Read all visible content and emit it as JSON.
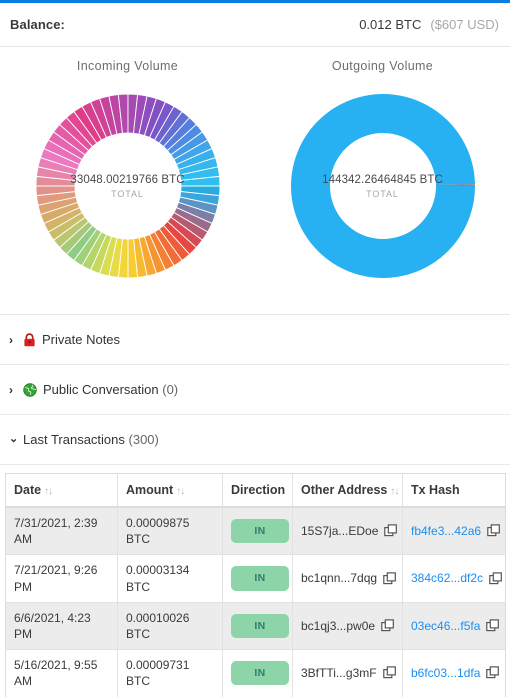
{
  "balance": {
    "label": "Balance:",
    "btc": "0.012 BTC",
    "usd": "($607 USD)"
  },
  "charts": [
    {
      "title": "Incoming Volume",
      "total": "33048.00219766 BTC",
      "subtitle": "TOTAL"
    },
    {
      "title": "Outgoing Volume",
      "total": "144342.26464845 BTC",
      "subtitle": "TOTAL"
    }
  ],
  "chart_data": [
    {
      "type": "pie",
      "title": "Incoming Volume",
      "center_label": "33048.00219766 BTC",
      "center_sublabel": "TOTAL",
      "unit": "BTC",
      "total": 33048.00219766,
      "segment_count": 60,
      "note": "Donut of many near-equal incoming transaction slices, rainbow palette, start angle 3 o'clock, clockwise",
      "values": [
        1,
        1,
        1,
        1,
        1,
        1,
        1,
        1,
        1,
        1,
        1,
        1,
        1,
        1,
        1,
        1,
        1,
        1,
        1,
        1,
        1,
        1,
        1,
        1,
        1,
        1,
        1,
        1,
        1,
        1,
        1,
        1,
        1,
        1,
        1,
        1,
        1,
        1,
        1,
        1,
        1,
        1,
        1,
        1,
        1,
        1,
        1,
        1,
        1,
        1,
        1,
        1,
        1,
        1,
        1,
        1,
        1,
        1,
        1,
        1
      ],
      "colors": [
        "#29abe2",
        "#3aa6dd",
        "#5b93c4",
        "#7b7fa8",
        "#9a6c8c",
        "#b85a6f",
        "#d64a55",
        "#e8473f",
        "#ef5a3a",
        "#f26c37",
        "#f48034",
        "#f59433",
        "#f6a832",
        "#f7bb31",
        "#f8cd31",
        "#f2d63a",
        "#e8db45",
        "#d9dd4f",
        "#c6d95c",
        "#b3d56a",
        "#a0d178",
        "#8fcd84",
        "#a6c97a",
        "#bcc570",
        "#c9bd6a",
        "#d2b368",
        "#d8aa6a",
        "#dda272",
        "#e09a7d",
        "#e2928a",
        "#e48b98",
        "#e685a7",
        "#e87fb6",
        "#ea79c2",
        "#e96fba",
        "#e765b0",
        "#e55ba6",
        "#e3519c",
        "#e14792",
        "#df3d88",
        "#d83f8f",
        "#cf4296",
        "#c6449d",
        "#bc46a4",
        "#b148ab",
        "#a64ab2",
        "#9b4cb8",
        "#8f4ebe",
        "#8350c4",
        "#7757ca",
        "#6b63d0",
        "#6070d6",
        "#567edc",
        "#4d8ce1",
        "#4599e5",
        "#3ea6e9",
        "#38b0ec",
        "#34b8ee",
        "#31bdef",
        "#2fc0f0"
      ]
    },
    {
      "type": "pie",
      "title": "Outgoing Volume",
      "center_label": "144342.26464845 BTC",
      "center_sublabel": "TOTAL",
      "unit": "BTC",
      "total": 144342.26464845,
      "segment_count": 2,
      "note": "One dominant outgoing slice plus a hairline slice at 3 o'clock",
      "values": [
        99.7,
        0.3
      ],
      "colors": [
        "#27b0f2",
        "#c0707a"
      ]
    }
  ],
  "sections": [
    {
      "label": "Private Notes",
      "count": "",
      "icon": "lock-icon",
      "expanded": false,
      "chevron": "›"
    },
    {
      "label": "Public Conversation",
      "count": "(0)",
      "icon": "globe-icon",
      "expanded": false,
      "chevron": "›"
    },
    {
      "label": "Last Transactions",
      "count": "(300)",
      "icon": "",
      "expanded": true,
      "chevron": "⌄"
    }
  ],
  "table": {
    "columns": [
      {
        "label": "Date",
        "sortable": true
      },
      {
        "label": "Amount",
        "sortable": true
      },
      {
        "label": "Direction",
        "sortable": false
      },
      {
        "label": "Other Address",
        "sortable": true
      },
      {
        "label": "Tx Hash",
        "sortable": false
      }
    ],
    "sort_glyph": "↑↓",
    "rows": [
      {
        "date": "7/31/2021, 2:39 AM",
        "amount": "0.00009875 BTC",
        "direction": "IN",
        "address": "15S7ja...EDoe",
        "hash": "fb4fe3...42a6"
      },
      {
        "date": "7/21/2021, 9:26 PM",
        "amount": "0.00003134 BTC",
        "direction": "IN",
        "address": "bc1qnn...7dqg",
        "hash": "384c62...df2c"
      },
      {
        "date": "6/6/2021, 4:23 PM",
        "amount": "0.00010026 BTC",
        "direction": "IN",
        "address": "bc1qj3...pw0e",
        "hash": "03ec46...f5fa"
      },
      {
        "date": "5/16/2021, 9:55 AM",
        "amount": "0.00009731 BTC",
        "direction": "IN",
        "address": "3BfTTi...g3mF",
        "hash": "b6fc03...1dfa"
      }
    ]
  },
  "colors": {
    "top_border": "#0b7ce4",
    "link": "#1b8ef2",
    "badge_bg": "#8ed4a9",
    "badge_text": "#2f7d69",
    "lock": "#d9201e",
    "globe": "#35a535"
  }
}
